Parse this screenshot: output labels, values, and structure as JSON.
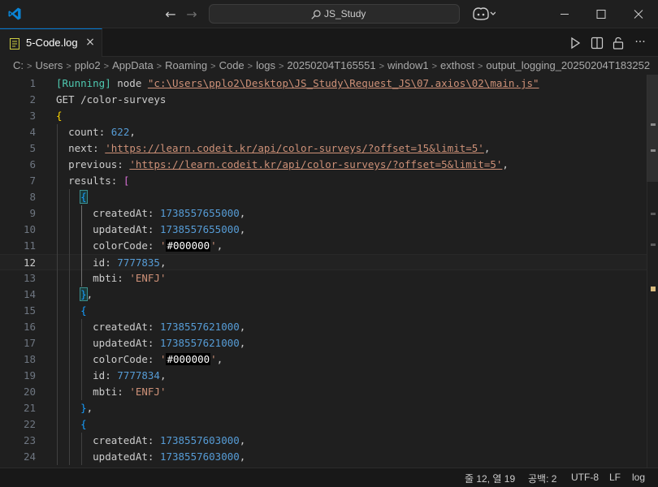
{
  "titlebar": {
    "search_label": "JS_Study",
    "nav_back": "←",
    "nav_forward": "→"
  },
  "tab": {
    "label": "5-Code.log",
    "close": "×"
  },
  "actions": {
    "more": "···"
  },
  "breadcrumb": [
    "C:",
    "Users",
    "pplo2",
    "AppData",
    "Roaming",
    "Code",
    "logs",
    "20250204T165551",
    "window1",
    "exthost",
    "output_logging_20250204T183252"
  ],
  "editor": {
    "current_line": 12,
    "lines": [
      {
        "n": "1",
        "t": "running",
        "running": "[Running]",
        "cmd": " node ",
        "path": "\"c:\\Users\\pplo2\\Desktop\\JS_Study\\Request_JS\\07.axios\\02\\main.js\""
      },
      {
        "n": "2",
        "t": "plain",
        "text": "GET /color-surveys"
      },
      {
        "n": "3",
        "t": "brace",
        "indent": "",
        "text": "{"
      },
      {
        "n": "4",
        "t": "kv",
        "indent": "  ",
        "key": "count",
        "val": "622",
        "vt": "num",
        "end": ","
      },
      {
        "n": "5",
        "t": "kv",
        "indent": "  ",
        "key": "next",
        "val": "'https://learn.codeit.kr/api/color-surveys/?offset=15&limit=5'",
        "vt": "link",
        "end": ","
      },
      {
        "n": "6",
        "t": "kv",
        "indent": "  ",
        "key": "previous",
        "val": "'https://learn.codeit.kr/api/color-surveys/?offset=5&limit=5'",
        "vt": "link",
        "end": ","
      },
      {
        "n": "7",
        "t": "kv",
        "indent": "  ",
        "key": "results",
        "val": "[",
        "vt": "brace2",
        "end": ""
      },
      {
        "n": "8",
        "t": "brace",
        "indent": "    ",
        "text": "{",
        "bt": "brace3",
        "hl": true
      },
      {
        "n": "9",
        "t": "kv",
        "indent": "      ",
        "key": "createdAt",
        "val": "1738557655000",
        "vt": "num",
        "end": ","
      },
      {
        "n": "10",
        "t": "kv",
        "indent": "      ",
        "key": "updatedAt",
        "val": "1738557655000",
        "vt": "num",
        "end": ","
      },
      {
        "n": "11",
        "t": "kv",
        "indent": "      ",
        "key": "colorCode",
        "val": "#000000",
        "vt": "swatch",
        "end": ","
      },
      {
        "n": "12",
        "t": "kv",
        "indent": "      ",
        "key": "id",
        "val": "7777835",
        "vt": "num",
        "end": ","
      },
      {
        "n": "13",
        "t": "kv",
        "indent": "      ",
        "key": "mbti",
        "val": "'ENFJ'",
        "vt": "str",
        "end": ""
      },
      {
        "n": "14",
        "t": "brace",
        "indent": "    ",
        "text": "}",
        "bt": "brace3",
        "hl": true,
        "end": ","
      },
      {
        "n": "15",
        "t": "brace",
        "indent": "    ",
        "text": "{",
        "bt": "brace3"
      },
      {
        "n": "16",
        "t": "kv",
        "indent": "      ",
        "key": "createdAt",
        "val": "1738557621000",
        "vt": "num",
        "end": ","
      },
      {
        "n": "17",
        "t": "kv",
        "indent": "      ",
        "key": "updatedAt",
        "val": "1738557621000",
        "vt": "num",
        "end": ","
      },
      {
        "n": "18",
        "t": "kv",
        "indent": "      ",
        "key": "colorCode",
        "val": "#000000",
        "vt": "swatch",
        "end": ","
      },
      {
        "n": "19",
        "t": "kv",
        "indent": "      ",
        "key": "id",
        "val": "7777834",
        "vt": "num",
        "end": ","
      },
      {
        "n": "20",
        "t": "kv",
        "indent": "      ",
        "key": "mbti",
        "val": "'ENFJ'",
        "vt": "str",
        "end": ""
      },
      {
        "n": "21",
        "t": "brace",
        "indent": "    ",
        "text": "}",
        "bt": "brace3",
        "end": ","
      },
      {
        "n": "22",
        "t": "brace",
        "indent": "    ",
        "text": "{",
        "bt": "brace3"
      },
      {
        "n": "23",
        "t": "kv",
        "indent": "      ",
        "key": "createdAt",
        "val": "1738557603000",
        "vt": "num",
        "end": ","
      },
      {
        "n": "24",
        "t": "kv",
        "indent": "      ",
        "key": "updatedAt",
        "val": "1738557603000",
        "vt": "num",
        "end": ","
      }
    ]
  },
  "statusbar": {
    "position": "줄 12, 열 19",
    "spaces": "공백: 2",
    "encoding": "UTF-8",
    "eol": "LF",
    "language": "log"
  },
  "colors": {
    "accent": "#0078d4",
    "vscode_logo": "#0a84d6"
  }
}
